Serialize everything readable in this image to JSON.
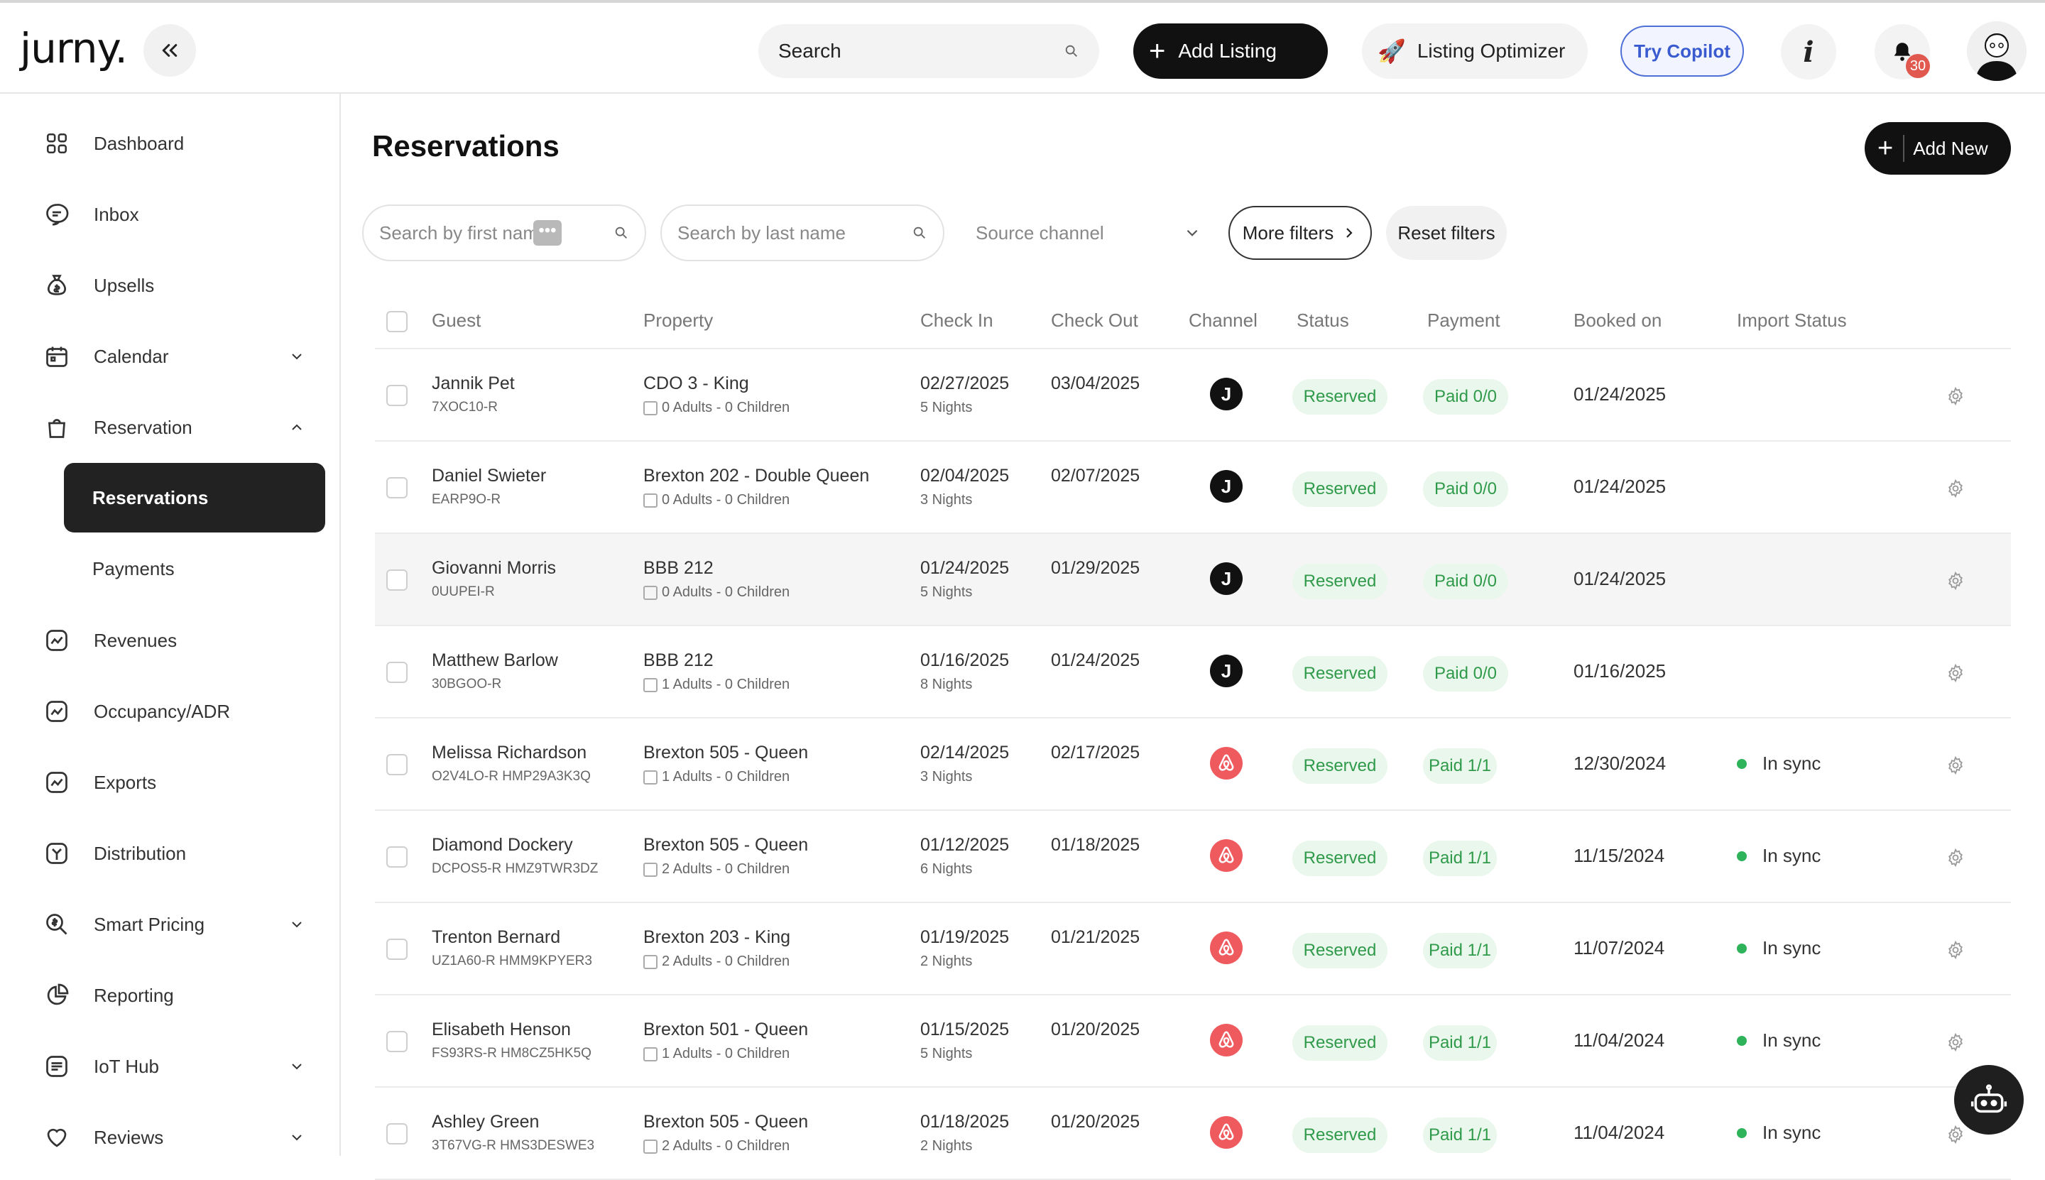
{
  "header": {
    "logo": "jurny.",
    "search_label": "Search",
    "add_listing": "Add Listing",
    "listing_optimizer": "Listing Optimizer",
    "optimizer_emoji": "🚀",
    "try_copilot": "Try Copilot",
    "info": "i",
    "notifications_count": "30"
  },
  "sidebar": {
    "dashboard": "Dashboard",
    "inbox": "Inbox",
    "upsells": "Upsells",
    "calendar": "Calendar",
    "reservation": "Reservation",
    "reservations": "Reservations",
    "payments": "Payments",
    "revenues": "Revenues",
    "occupancy": "Occupancy/ADR",
    "exports": "Exports",
    "distribution": "Distribution",
    "smart_pricing": "Smart Pricing",
    "reporting": "Reporting",
    "iot_hub": "IoT Hub",
    "reviews": "Reviews"
  },
  "main": {
    "title": "Reservations",
    "add_new": "Add New",
    "filters": {
      "first_name_placeholder": "Search by first nam",
      "last_name_placeholder": "Search by last name",
      "source_channel": "Source channel",
      "more_filters": "More filters",
      "reset_filters": "Reset filters"
    },
    "columns": {
      "guest": "Guest",
      "property": "Property",
      "check_in": "Check In",
      "check_out": "Check Out",
      "channel": "Channel",
      "status": "Status",
      "payment": "Payment",
      "booked_on": "Booked on",
      "import_status": "Import Status"
    },
    "rows": [
      {
        "guest": "Jannik Pet",
        "code": "7XOC10-R",
        "property": "CDO 3 - King",
        "occupancy": "0 Adults - 0 Children",
        "check_in": "02/27/2025",
        "nights": "5 Nights",
        "check_out": "03/04/2025",
        "channel_letter": "J",
        "status": "Reserved",
        "payment": "Paid 0/0",
        "booked": "01/24/2025",
        "import": ""
      },
      {
        "guest": "Daniel Swieter",
        "code": "EARP9O-R",
        "property": "Brexton 202 - Double Queen",
        "occupancy": "0 Adults - 0 Children",
        "check_in": "02/04/2025",
        "nights": "3 Nights",
        "check_out": "02/07/2025",
        "channel_letter": "J",
        "status": "Reserved",
        "payment": "Paid 0/0",
        "booked": "01/24/2025",
        "import": ""
      },
      {
        "guest": "Giovanni Morris",
        "code": "0UUPEI-R",
        "property": "BBB 212",
        "occupancy": "0 Adults - 0 Children",
        "check_in": "01/24/2025",
        "nights": "5 Nights",
        "check_out": "01/29/2025",
        "channel_letter": "J",
        "status": "Reserved",
        "payment": "Paid 0/0",
        "booked": "01/24/2025",
        "import": ""
      },
      {
        "guest": "Matthew Barlow",
        "code": "30BGOO-R",
        "property": "BBB 212",
        "occupancy": "1 Adults - 0 Children",
        "check_in": "01/16/2025",
        "nights": "8 Nights",
        "check_out": "01/24/2025",
        "channel_letter": "J",
        "status": "Reserved",
        "payment": "Paid 0/0",
        "booked": "01/16/2025",
        "import": ""
      },
      {
        "guest": "Melissa Richardson",
        "code": "O2V4LO-R HMP29A3K3Q",
        "property": "Brexton 505 - Queen",
        "occupancy": "1 Adults - 0 Children",
        "check_in": "02/14/2025",
        "nights": "3 Nights",
        "check_out": "02/17/2025",
        "channel_letter": "",
        "status": "Reserved",
        "payment": "Paid 1/1",
        "booked": "12/30/2024",
        "import": "In sync"
      },
      {
        "guest": "Diamond Dockery",
        "code": "DCPOS5-R HMZ9TWR3DZ",
        "property": "Brexton 505 - Queen",
        "occupancy": "2 Adults - 0 Children",
        "check_in": "01/12/2025",
        "nights": "6 Nights",
        "check_out": "01/18/2025",
        "channel_letter": "",
        "status": "Reserved",
        "payment": "Paid 1/1",
        "booked": "11/15/2024",
        "import": "In sync"
      },
      {
        "guest": "Trenton Bernard",
        "code": "UZ1A60-R HMM9KPYER3",
        "property": "Brexton 203 - King",
        "occupancy": "2 Adults - 0 Children",
        "check_in": "01/19/2025",
        "nights": "2 Nights",
        "check_out": "01/21/2025",
        "channel_letter": "",
        "status": "Reserved",
        "payment": "Paid 1/1",
        "booked": "11/07/2024",
        "import": "In sync"
      },
      {
        "guest": "Elisabeth Henson",
        "code": "FS93RS-R HM8CZ5HK5Q",
        "property": "Brexton 501 - Queen",
        "occupancy": "1 Adults - 0 Children",
        "check_in": "01/15/2025",
        "nights": "5 Nights",
        "check_out": "01/20/2025",
        "channel_letter": "",
        "status": "Reserved",
        "payment": "Paid 1/1",
        "booked": "11/04/2024",
        "import": "In sync"
      },
      {
        "guest": "Ashley Green",
        "code": "3T67VG-R HMS3DESWE3",
        "property": "Brexton 505 - Queen",
        "occupancy": "2 Adults - 0 Children",
        "check_in": "01/18/2025",
        "nights": "2 Nights",
        "check_out": "01/20/2025",
        "channel_letter": "",
        "status": "Reserved",
        "payment": "Paid 1/1",
        "booked": "11/04/2024",
        "import": "In sync"
      }
    ]
  },
  "colors": {
    "accent_dark": "#111111",
    "status_green": "#2f9a4a",
    "status_bg": "#eaf7ec",
    "airbnb": "#ef5a5f",
    "copilot_blue": "#3a5bd0",
    "badge_red": "#e0584e"
  }
}
